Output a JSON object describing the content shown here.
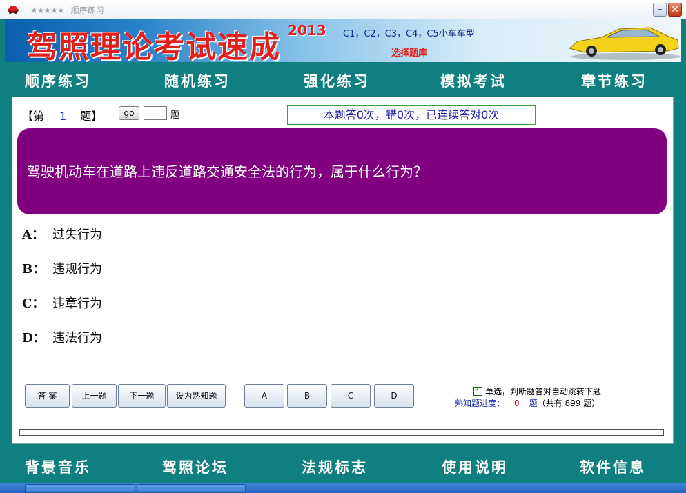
{
  "window": {
    "title_stars": "★★★★★",
    "title": "顺序练习",
    "minimize_glyph": "–",
    "close_glyph": "✕"
  },
  "banner": {
    "app_name": "驾照理论考试速成",
    "year": "2013",
    "models": "C1，C2，C3，C4，C5小车车型",
    "select_bank": "选择题库",
    "title_color": "#e0201c"
  },
  "nav_top": [
    "顺序练习",
    "随机练习",
    "强化练习",
    "模拟考试",
    "章节练习"
  ],
  "nav_bottom": [
    "背景音乐",
    "驾照论坛",
    "法规标志",
    "使用说明",
    "软件信息"
  ],
  "question_header": {
    "prefix": "【第",
    "number": "1",
    "suffix": "题】",
    "go_label": "go",
    "goto_value": "",
    "goto_suffix": "题"
  },
  "stats": "本题答0次，错0次，已连续答对0次",
  "question": {
    "text": "驾驶机动车在道路上违反道路交通安全法的行为，属于什么行为？",
    "bg_color": "#800080"
  },
  "options": [
    {
      "letter": "A：",
      "text": "过失行为"
    },
    {
      "letter": "B：",
      "text": "违规行为"
    },
    {
      "letter": "C：",
      "text": "违章行为"
    },
    {
      "letter": "D：",
      "text": "违法行为"
    }
  ],
  "buttons": {
    "answer": "答 案",
    "prev": "上一题",
    "next": "下一题",
    "mark_known": "设为熟知题",
    "a": "A",
    "b": "B",
    "c": "C",
    "d": "D"
  },
  "auto_jump": {
    "checked": true,
    "label": "单选，判断题答对自动跳转下题"
  },
  "progress": {
    "label": "熟知题进度：",
    "known_count": "0",
    "unit": "题",
    "total_text": "（共有  899  题）",
    "value": 0
  },
  "colors": {
    "frame": "#0f7f7f",
    "nav_text": "#ffffff",
    "link_blue": "#1a2ab0",
    "accent_red": "#d01010"
  }
}
